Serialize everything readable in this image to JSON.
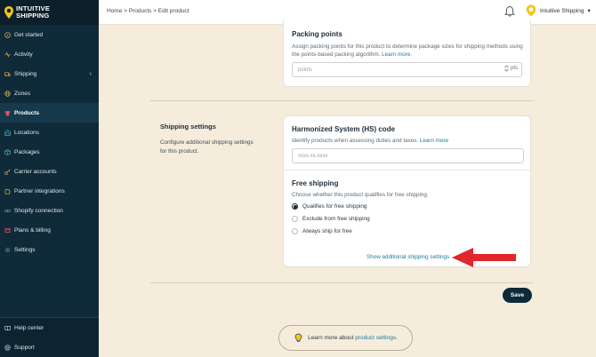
{
  "brand": {
    "name_line1": "INTUITIVE",
    "name_line2": "SHIPPING"
  },
  "sidebar": {
    "items": [
      {
        "label": "Get started",
        "icon": "compass-icon"
      },
      {
        "label": "Activity",
        "icon": "activity-icon"
      },
      {
        "label": "Shipping",
        "icon": "truck-icon",
        "has_submenu": true
      },
      {
        "label": "Zones",
        "icon": "globe-icon"
      },
      {
        "label": "Products",
        "icon": "shirt-icon",
        "active": true
      },
      {
        "label": "Locations",
        "icon": "warehouse-icon"
      },
      {
        "label": "Packages",
        "icon": "package-icon"
      },
      {
        "label": "Carrier accounts",
        "icon": "key-icon"
      },
      {
        "label": "Partner integrations",
        "icon": "puzzle-icon"
      },
      {
        "label": "Shopify connection",
        "icon": "link-icon"
      },
      {
        "label": "Plans & billing",
        "icon": "receipt-icon"
      },
      {
        "label": "Settings",
        "icon": "gear-icon"
      }
    ],
    "bottom": [
      {
        "label": "Help center",
        "icon": "book-icon"
      },
      {
        "label": "Support",
        "icon": "help-icon"
      }
    ],
    "chevron": "›"
  },
  "header": {
    "breadcrumb": "Home > Products > Edit product",
    "user_name": "Intuitive Shipping",
    "user_caret": "▾"
  },
  "packing": {
    "title": "Packing points",
    "desc_line1": "Assign packing points for this product to determine package sizes for shipping methods using",
    "desc_line2": "the points-based packing algorithm.",
    "learn_more": "Learn more.",
    "placeholder": "points",
    "unit": "pts"
  },
  "shipping_settings": {
    "title": "Shipping settings",
    "desc": "Configure additional shipping settings for this product."
  },
  "hs": {
    "title": "Harmonized System (HS) code",
    "desc": "Identify products when assessing duties and taxes.",
    "learn_more": "Learn more",
    "placeholder": "xxxx.xx.xxxx"
  },
  "free_shipping": {
    "title": "Free shipping",
    "desc": "Choose whether this product qualifies for free shipping.",
    "options": [
      {
        "label": "Qualifies for free shipping",
        "selected": true
      },
      {
        "label": "Exclude from free shipping",
        "selected": false
      },
      {
        "label": "Always ship for free",
        "selected": false
      }
    ],
    "show_more": "Show additional shipping settings"
  },
  "actions": {
    "save": "Save"
  },
  "learn": {
    "prefix": "Learn more about",
    "link": "product settings."
  },
  "colors": {
    "sidebar": "#0f2a38",
    "accent_link": "#1f7a9c",
    "arrow": "#e3262b",
    "background": "#f6ecdc"
  }
}
